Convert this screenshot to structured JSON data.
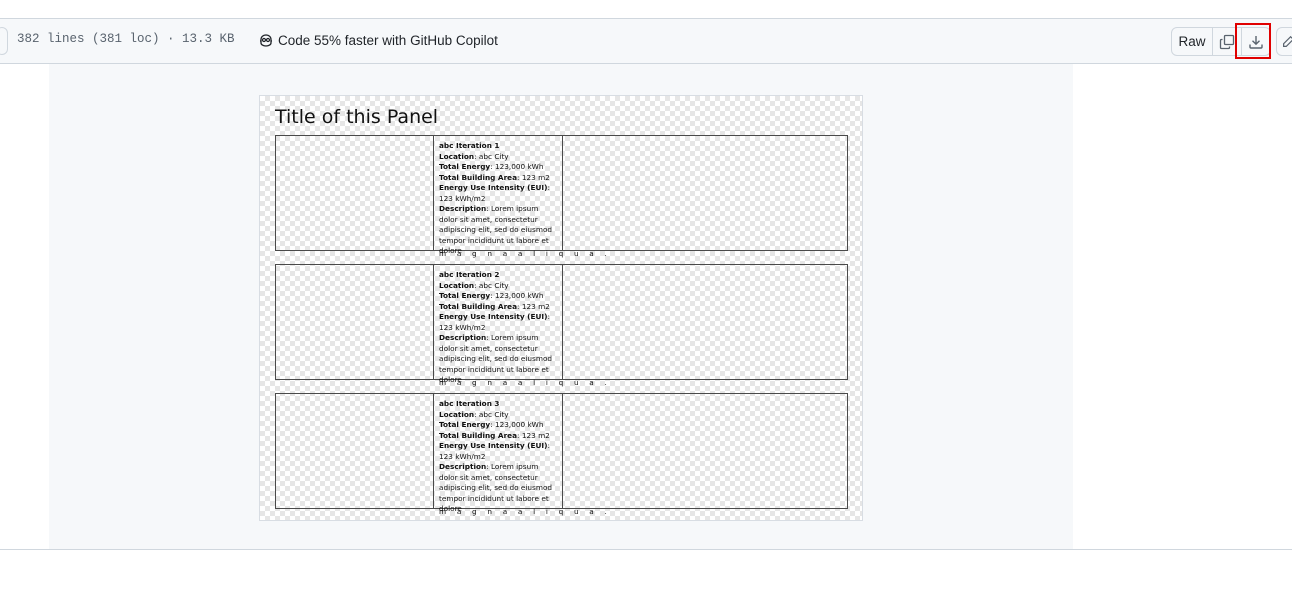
{
  "file_header": {
    "file_info": "382 lines (381 loc) · 13.3 KB",
    "copilot_text": "Code 55% faster with GitHub Copilot",
    "raw_label": "Raw"
  },
  "panel": {
    "title": "Title of this Panel",
    "rows": [
      {
        "heading": "abc Iteration 1",
        "location_label": "Location",
        "location": ": abc City",
        "energy_label": "Total Energy",
        "energy": ": 123,000 kWh",
        "area_label": "Total Building Area",
        "area": ": 123 m2",
        "eui_label": "Energy Use Intensity (EUI)",
        "eui": ": 123 kWh/m2",
        "desc_label": "Description",
        "desc": ": Lorem ipsum dolor sit amet, consectetur adipiscing elit, sed do eiusmod tempor incididunt ut labore et dolore",
        "overflow": "m a g n a a l i q u a ."
      },
      {
        "heading": "abc Iteration 2",
        "location_label": "Location",
        "location": ": abc City",
        "energy_label": "Total Energy",
        "energy": ": 123,000 kWh",
        "area_label": "Total Building Area",
        "area": ": 123 m2",
        "eui_label": "Energy Use Intensity (EUI)",
        "eui": ": 123 kWh/m2",
        "desc_label": "Description",
        "desc": ": Lorem ipsum dolor sit amet, consectetur adipiscing elit, sed do eiusmod tempor incididunt ut labore et dolore",
        "overflow": "m a g n a a l i q u a ."
      },
      {
        "heading": "abc Iteration 3",
        "location_label": "Location",
        "location": ": abc City",
        "energy_label": "Total Energy",
        "energy": ": 123,000 kWh",
        "area_label": "Total Building Area",
        "area": ": 123 m2",
        "eui_label": "Energy Use Intensity (EUI)",
        "eui": ": 123 kWh/m2",
        "desc_label": "Description",
        "desc": ": Lorem ipsum dolor sit amet, consectetur adipiscing elit, sed do eiusmod tempor incididunt ut labore et dolore",
        "overflow": "m a g n a a l i q u a ."
      }
    ]
  },
  "icons": {
    "copilot": "copilot-icon",
    "copy": "copy-icon",
    "download": "download-icon",
    "edit": "pencil-icon"
  },
  "colors": {
    "highlight": "#e00000",
    "header_bg": "#f6f8fa",
    "border": "#d0d7de"
  }
}
